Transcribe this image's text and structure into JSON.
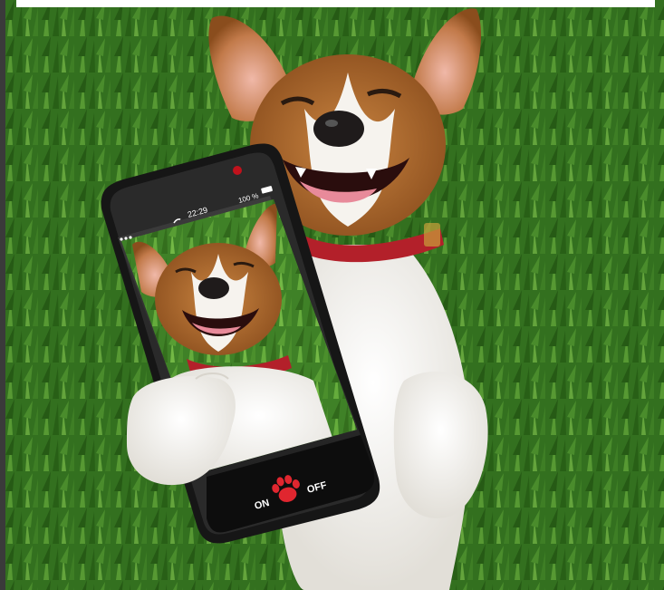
{
  "phone": {
    "time": "22:29",
    "battery": "100 %",
    "on_label": "ON",
    "off_label": "OFF"
  },
  "colors": {
    "grass_dark": "#2f6b1f",
    "grass_light": "#5fa63a",
    "fur_white": "#f2f0ec",
    "fur_brown": "#b8702f",
    "collar_red": "#b3202a",
    "phone_body": "#1a1a1a",
    "paw_red": "#e0262f"
  }
}
